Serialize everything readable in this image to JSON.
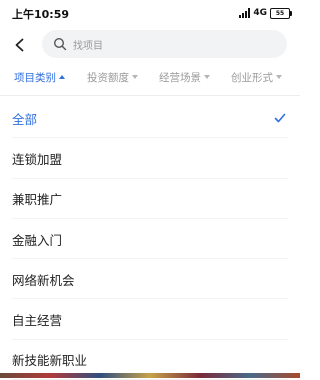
{
  "status_bar": {
    "time": "上午10:59",
    "network": "4G",
    "battery": "55"
  },
  "header": {
    "search_placeholder": "找项目"
  },
  "filters": [
    {
      "label": "项目类别",
      "active": true
    },
    {
      "label": "投资额度",
      "active": false
    },
    {
      "label": "经营场景",
      "active": false
    },
    {
      "label": "创业形式",
      "active": false
    }
  ],
  "options": [
    {
      "label": "全部",
      "selected": true
    },
    {
      "label": "连锁加盟",
      "selected": false
    },
    {
      "label": "兼职推广",
      "selected": false
    },
    {
      "label": "金融入门",
      "selected": false
    },
    {
      "label": "网络新机会",
      "selected": false
    },
    {
      "label": "自主经营",
      "selected": false
    },
    {
      "label": "新技能新职业",
      "selected": false
    }
  ],
  "colors": {
    "accent": "#2f6fe0",
    "muted_text": "#9a9a9a",
    "text": "#222222"
  }
}
